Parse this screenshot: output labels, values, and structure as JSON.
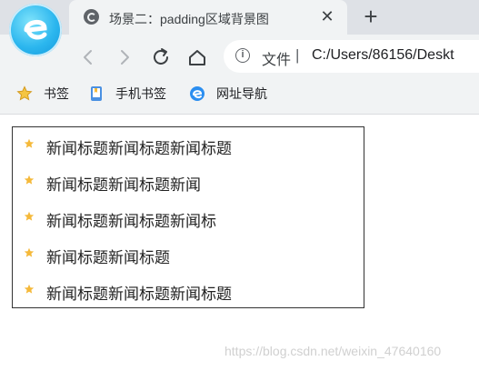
{
  "browser": {
    "tab": {
      "title": "场景二：padding区域背景图",
      "close_glyph": "✕",
      "favicon": "e-browser-favicon-icon"
    },
    "new_tab_glyph": "+",
    "address_bar": {
      "security_label": "文件",
      "separator": "|",
      "url": "C:/Users/86156/Deskt"
    },
    "bookmarks": [
      {
        "label": "书签",
        "icon": "star-icon"
      },
      {
        "label": "手机书签",
        "icon": "phone-bookmark-icon"
      },
      {
        "label": "网址导航",
        "icon": "nav-icon"
      }
    ],
    "colors": {
      "tab_strip": "#dee1e6",
      "toolbar": "#f1f3f4",
      "logo_blue": "#2bb6ee",
      "star": "#f5b93a"
    }
  },
  "page": {
    "news": [
      {
        "title": "新闻标题新闻标题新闻标题"
      },
      {
        "title": "新闻标题新闻标题新闻"
      },
      {
        "title": "新闻标题新闻标题新闻标"
      },
      {
        "title": "新闻标题新闻标题"
      },
      {
        "title": "新闻标题新闻标题新闻标题"
      }
    ],
    "watermark": "https://blog.csdn.net/weixin_47640160"
  }
}
